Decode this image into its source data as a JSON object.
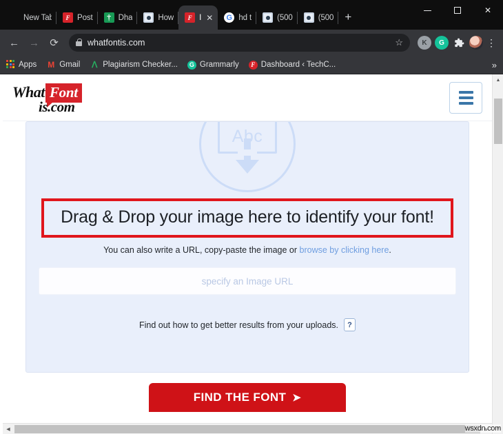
{
  "window": {
    "controls": {
      "minimize": "minimize-button",
      "maximize": "maximize-button",
      "close_label": "✕"
    }
  },
  "tabs": [
    {
      "label": "New Tab",
      "icon": "blank-icon",
      "active": false,
      "closeable": false
    },
    {
      "label": "Post",
      "icon": "flipboard-icon",
      "active": false,
      "closeable": false
    },
    {
      "label": "Dha",
      "icon": "sheets-icon",
      "active": false,
      "closeable": false
    },
    {
      "label": "How",
      "icon": "camera-frame-icon",
      "active": false,
      "closeable": false
    },
    {
      "label": "I",
      "icon": "whatfontis-icon",
      "active": true,
      "closeable": true,
      "close_label": "✕"
    },
    {
      "label": "hd t",
      "icon": "google-icon",
      "active": false,
      "closeable": false
    },
    {
      "label": "(500",
      "icon": "camera-frame-icon",
      "active": false,
      "closeable": false
    },
    {
      "label": "(500",
      "icon": "camera-frame-icon",
      "active": false,
      "closeable": false
    }
  ],
  "new_tab_button": "+",
  "toolbar": {
    "back": "←",
    "forward": "→",
    "reload": "⟳",
    "url": "whatfontis.com",
    "star": "☆",
    "extensions": [
      {
        "name": "kami-extension",
        "label": "K"
      },
      {
        "name": "grammarly-extension",
        "label": "G"
      },
      {
        "name": "extensions-puzzle",
        "label": "🧩"
      }
    ],
    "profile_avatar": "avatar",
    "menu": "⋮"
  },
  "bookmarks": {
    "items": [
      {
        "label": "Apps",
        "icon": "apps-grid-icon"
      },
      {
        "label": "Gmail",
        "icon": "gmail-icon",
        "glyph": "M"
      },
      {
        "label": "Plagiarism Checker...",
        "icon": "plagiarism-icon",
        "glyph": "ᐱ"
      },
      {
        "label": "Grammarly",
        "icon": "grammarly-icon",
        "glyph": "G"
      },
      {
        "label": "Dashboard ‹ TechC...",
        "icon": "dashboard-icon",
        "glyph": "F"
      }
    ],
    "overflow": "»"
  },
  "site": {
    "logo": {
      "part1": "What",
      "part2": "Font",
      "part3": "is.com"
    },
    "menu_button": "hamburger-menu"
  },
  "upload": {
    "drop_icon_text": "Abc",
    "headline": "Drag & Drop your image here to identify your font!",
    "subline_prefix": "You can also write a URL, copy-paste the image or ",
    "subline_link": "browse by clicking here",
    "subline_suffix": ".",
    "url_placeholder": "specify an Image URL",
    "url_value": "",
    "help_text": "Find out how to get better results from your uploads.",
    "help_badge": "?",
    "submit_label": "FIND THE FONT",
    "submit_arrow": "➤"
  },
  "scrollbars": {
    "v_up": "▲",
    "v_down": "▼",
    "h_left": "◀",
    "h_right": "▶"
  },
  "watermark": "wsxdn.com",
  "colors": {
    "brand_red": "#d6232a",
    "button_red": "#cf1217",
    "highlight_red": "#e0161c",
    "panel_blue": "#e9effb",
    "icon_blue": "#ccdcf7",
    "link_blue": "#6f9ee0",
    "chrome_dark": "#35363a",
    "tabstrip_dark": "#0e0e0e"
  }
}
